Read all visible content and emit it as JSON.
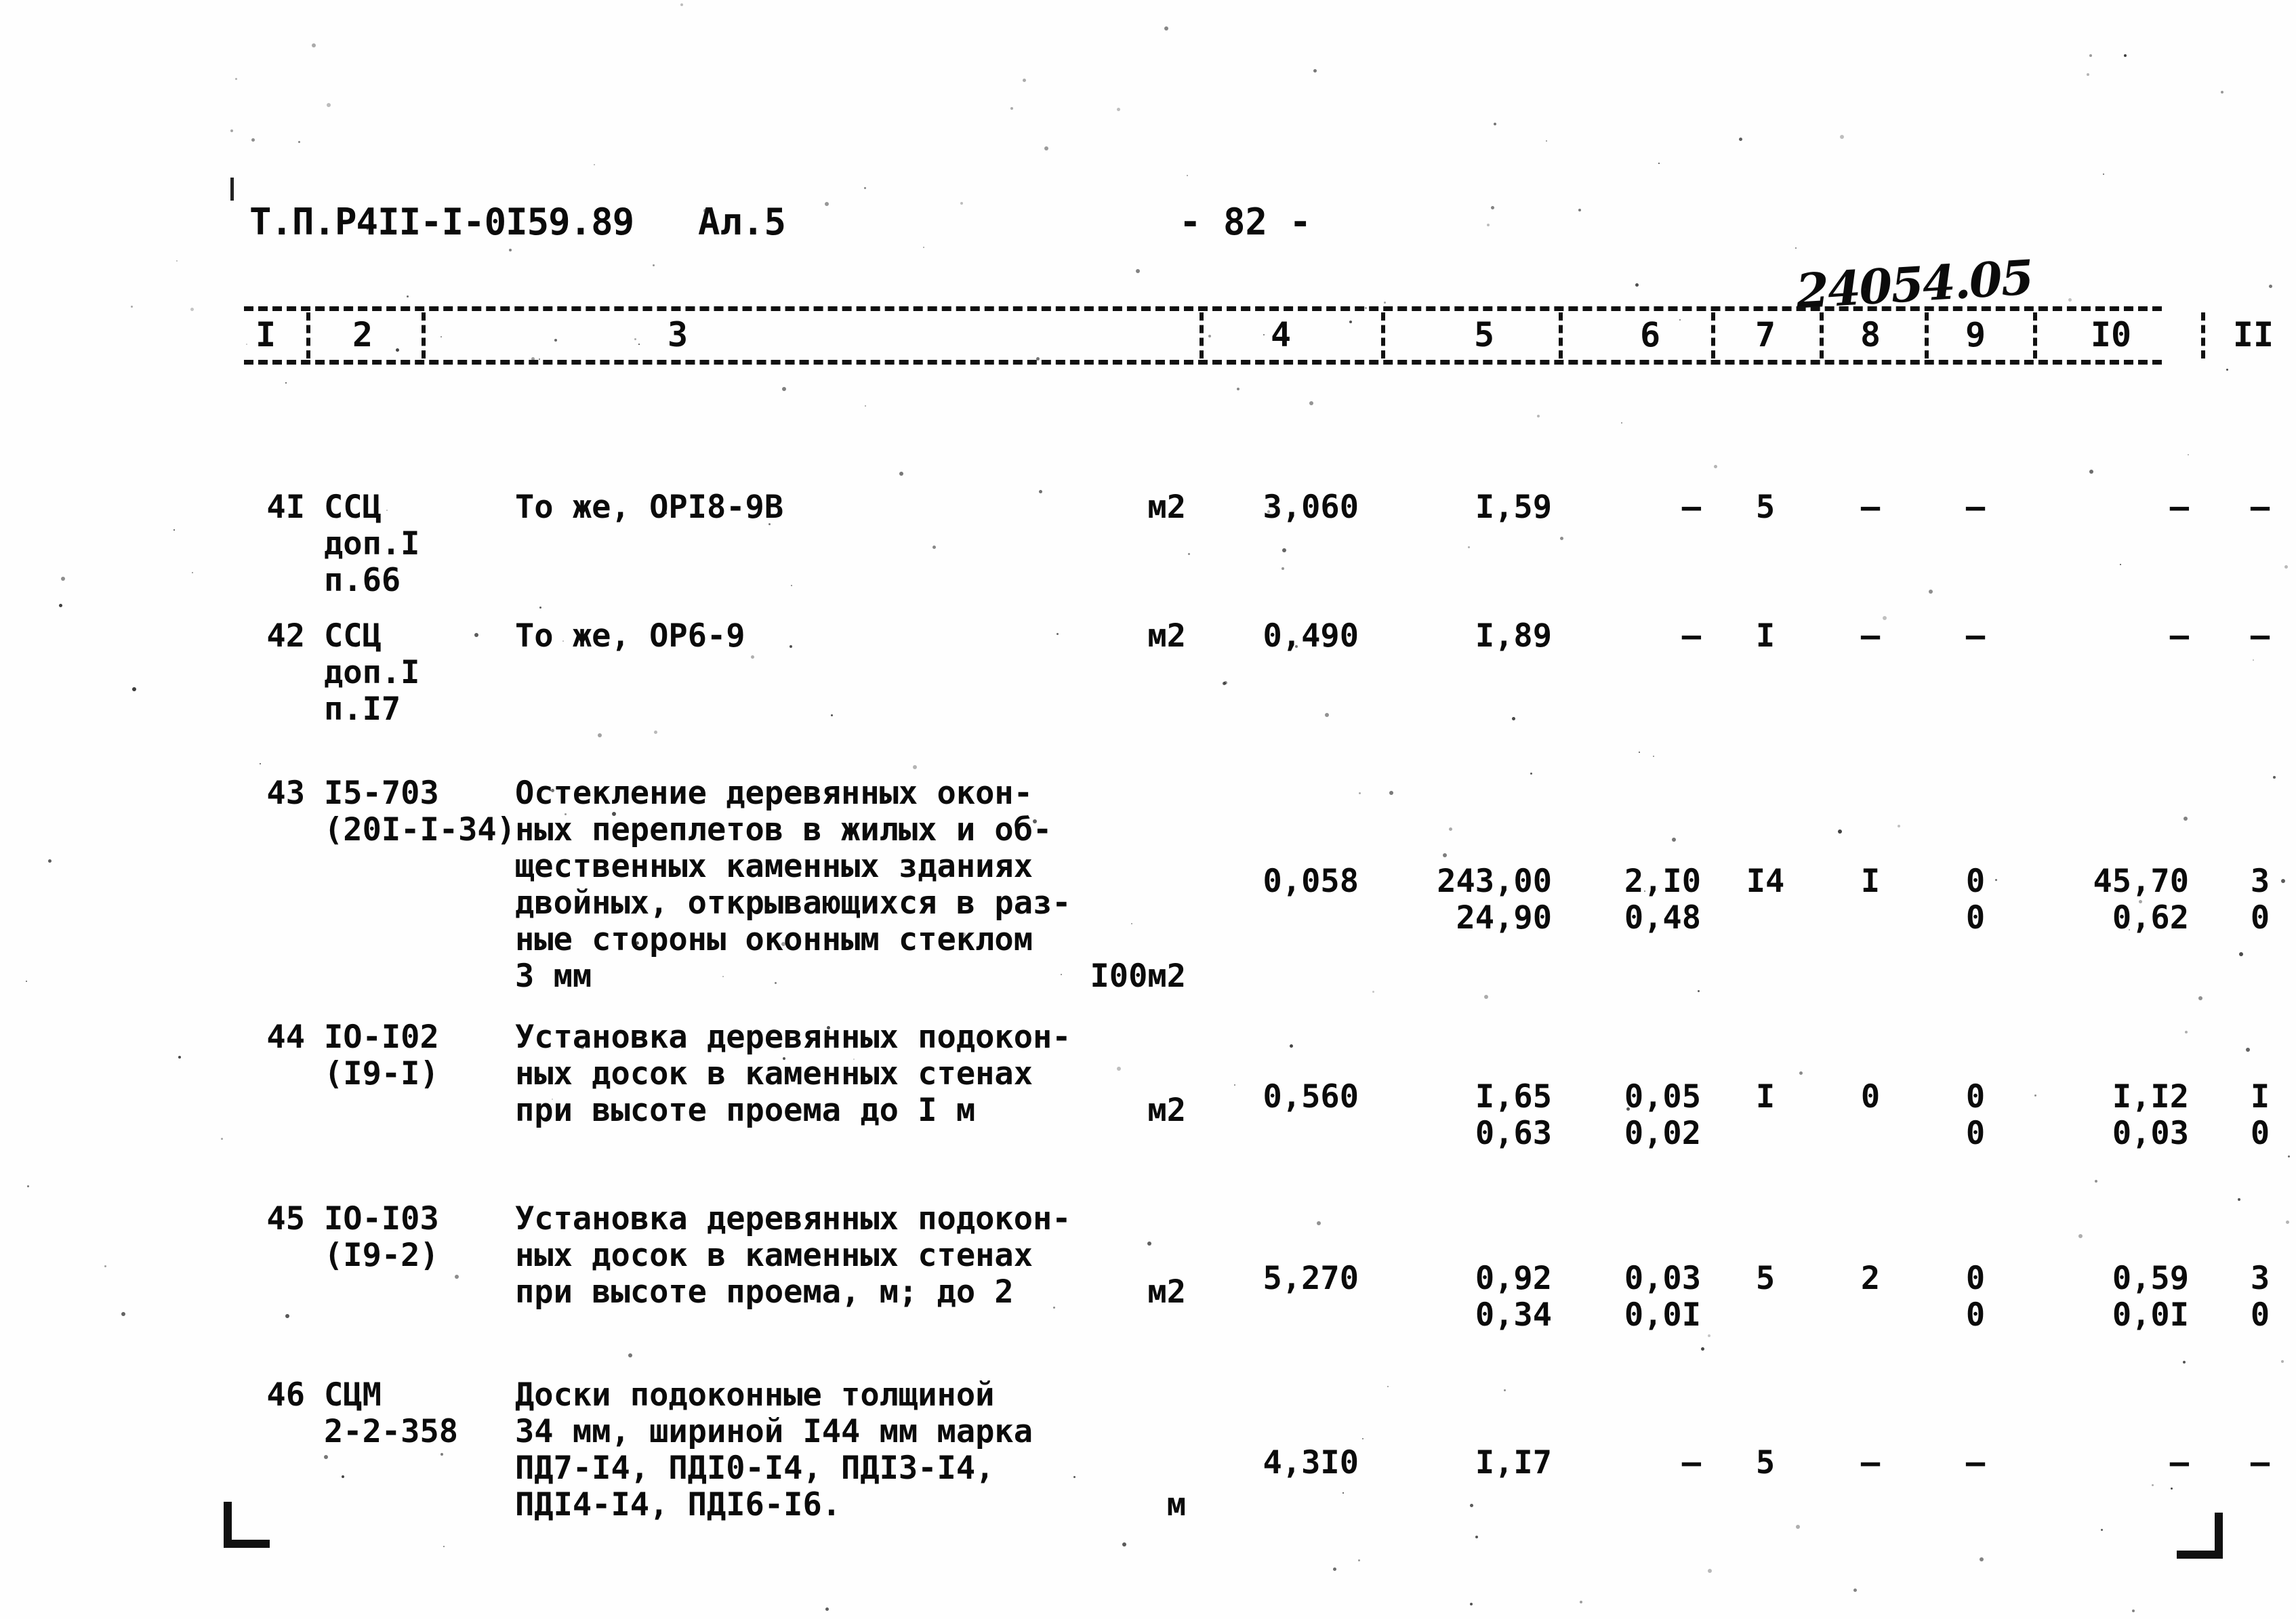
{
  "header": {
    "doc_code": "Т.П.Р4II-I-0I59.89",
    "album": "Ал.5",
    "page_number": "- 82 -",
    "handwritten_note": "24054.05"
  },
  "table": {
    "column_headers": [
      "I",
      "2",
      "3",
      "4",
      "5",
      "6",
      "7",
      "8",
      "9",
      "I0",
      "II"
    ],
    "rows": [
      {
        "num": "4I",
        "code": "ССЦ\nдоп.I\nп.66",
        "description": "То же, ОРI8-9В",
        "unit": "м2",
        "c4": "3,060",
        "c5": "I,59",
        "c6": "–",
        "c7": "5",
        "c8": "–",
        "c9": "–",
        "c10": "–",
        "c11": "–"
      },
      {
        "num": "42",
        "code": "ССЦ\nдоп.I\nп.I7",
        "description": "То же, ОР6-9",
        "unit": "м2",
        "c4": "0,490",
        "c5": "I,89",
        "c6": "–",
        "c7": "I",
        "c8": "–",
        "c9": "–",
        "c10": "–",
        "c11": "–"
      },
      {
        "num": "43",
        "code": "I5-703\n(20I-I-34)",
        "description": "Остекление деревянных окон-\nных переплетов в жилых и об-\nщественных каменных зданиях\nдвойных, открывающихся в раз-\nные стороны оконным стеклом\n3 мм",
        "unit": "I00м2",
        "c4": "0,058",
        "c5": "243,00\n24,90",
        "c6": "2,I0\n0,48",
        "c7": "I4",
        "c8": "I",
        "c9": "0\n0",
        "c10": "45,70\n0,62",
        "c11": "3\n0"
      },
      {
        "num": "44",
        "code": "IО-I02\n(I9-I)",
        "description": "Установка деревянных подокон-\nных досок в каменных стенах\nпри высоте проема до I м",
        "unit": "м2",
        "c4": "0,560",
        "c5": "I,65\n0,63",
        "c6": "0,05\n0,02",
        "c7": "I",
        "c8": "0",
        "c9": "0\n0",
        "c10": "I,I2\n0,03",
        "c11": "I\n0"
      },
      {
        "num": "45",
        "code": "IО-I03\n(I9-2)",
        "description": "Установка деревянных подокон-\nных досок в каменных стенах\nпри высоте проема, м; до 2",
        "unit": "м2",
        "c4": "5,270",
        "c5": "0,92\n0,34",
        "c6": "0,03\n0,0I",
        "c7": "5",
        "c8": "2",
        "c9": "0\n0",
        "c10": "0,59\n0,0I",
        "c11": "3\n0"
      },
      {
        "num": "46",
        "code": "СЦМ\n2-2-358",
        "description": "Доски подоконные толщиной\n34 мм, шириной I44 мм марка\nПД7-I4, ПДI0-I4, ПДI3-I4,\nПДI4-I4, ПДI6-I6.",
        "unit": "м",
        "c4": "4,3I0",
        "c5": "I,I7",
        "c6": "–",
        "c7": "5",
        "c8": "–",
        "c9": "–",
        "c10": "–",
        "c11": "–"
      }
    ]
  },
  "layout": {
    "header_col_centers": [
      32,
      175,
      640,
      1530,
      1830,
      2075,
      2245,
      2400,
      2555,
      2755,
      2965
    ],
    "header_separators": [
      92,
      262,
      1410,
      1678,
      1940,
      2165,
      2325,
      2480,
      2640,
      2888
    ],
    "row_tops": [
      150,
      340,
      572,
      932,
      1200,
      1460
    ],
    "desc_offsets": [
      0,
      0,
      0,
      0,
      0,
      0
    ],
    "num_offsets": [
      0,
      0,
      130,
      88,
      88,
      100
    ]
  }
}
